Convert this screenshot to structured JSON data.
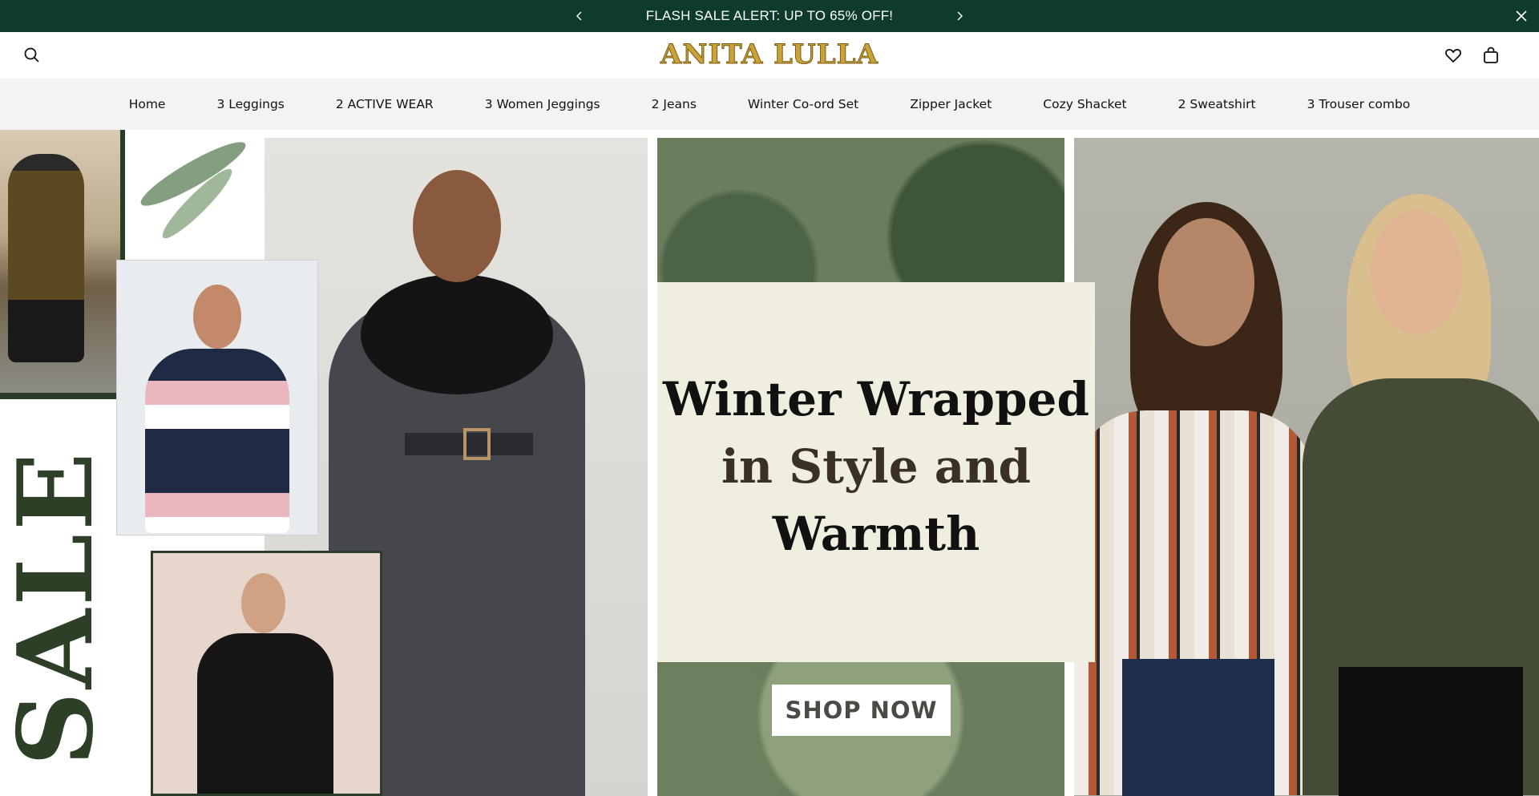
{
  "announcement": {
    "text": "FLASH SALE ALERT: UP TO 65% OFF!",
    "prev_icon": "chevron-left-icon",
    "next_icon": "chevron-right-icon",
    "close_icon": "close-icon",
    "background": "#0f3b2e"
  },
  "header": {
    "logo_text": "ANITA LULLA",
    "search_icon": "search-icon",
    "wishlist_icon": "heart-icon",
    "cart_icon": "bag-icon",
    "logo_color": "#c9a23a"
  },
  "nav": {
    "items": [
      {
        "label": "Home"
      },
      {
        "label": "3 Leggings"
      },
      {
        "label": "2 ACTIVE WEAR"
      },
      {
        "label": "3 Women Jeggings"
      },
      {
        "label": "2 Jeans"
      },
      {
        "label": "Winter Co-ord Set"
      },
      {
        "label": "Zipper Jacket"
      },
      {
        "label": "Cozy Shacket"
      },
      {
        "label": "2 Sweatshirt"
      },
      {
        "label": "3 Trouser combo"
      }
    ]
  },
  "hero": {
    "sale_word": "SALE",
    "headline_line1": "Winter Wrapped",
    "headline_line2": "in Style and",
    "headline_line3": "Warmth",
    "cta_label": "SHOP NOW",
    "accent_green": "#2d3f27"
  }
}
